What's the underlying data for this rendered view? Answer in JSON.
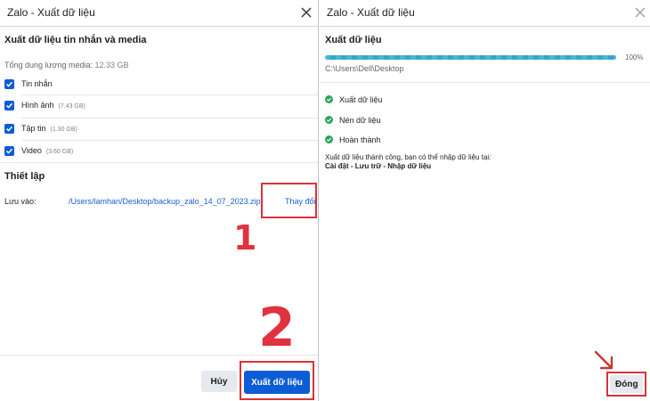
{
  "left_dialog": {
    "title": "Zalo - Xuất dữ liệu",
    "section_title": "Xuất dữ liệu tin nhắn và media",
    "total_media_label": "Tổng dung lượng media:",
    "total_media_size": "12.33 GB",
    "items": [
      {
        "label": "Tin nhắn",
        "size": "",
        "checked": true
      },
      {
        "label": "Hình ảnh",
        "size": "(7.43 GB)",
        "checked": true
      },
      {
        "label": "Tập tin",
        "size": "(1.30 GB)",
        "checked": true
      },
      {
        "label": "Video",
        "size": "(3.60 GB)",
        "checked": true
      }
    ],
    "settings_title": "Thiết lập",
    "save_to_label": "Lưu vào:",
    "save_path": "/Users/lamhan/Desktop/backup_zalo_14_07_2023.zip",
    "change_label": "Thay đổi",
    "cancel_label": "Hủy",
    "export_label": "Xuất dữ liệu"
  },
  "annotations": {
    "step1": "1",
    "step2": "2",
    "red": "#d8333a"
  },
  "right_dialog": {
    "title": "Zalo - Xuất dữ liệu",
    "section_title": "Xuất dữ liệu",
    "progress_percent_label": "100%",
    "progress_value": 1.0,
    "destination": "C:\\Users\\Dell\\Desktop",
    "steps": [
      {
        "label": "Xuất dữ liệu",
        "done": true
      },
      {
        "label": "Nén dữ liệu",
        "done": true
      },
      {
        "label": "Hoàn thành",
        "done": true
      }
    ],
    "success_message": "Xuất dữ liệu thành công, bạn có thể nhập dữ liệu tại:",
    "success_path": "Cài đặt - Lưu trữ - Nhập dữ liệu",
    "close_label": "Đóng"
  },
  "colors": {
    "accent": "#0b5cd5",
    "success": "#2aa55a",
    "progress": "#49b6d6"
  }
}
